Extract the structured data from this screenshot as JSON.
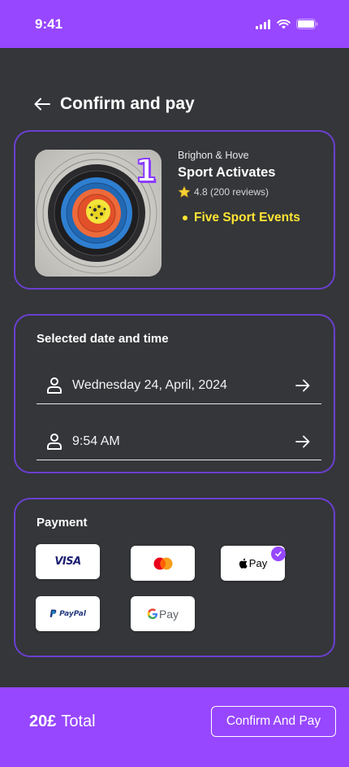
{
  "status_bar": {
    "time": "9:41",
    "background": "#9747ff"
  },
  "header": {
    "title": "Confirm and pay",
    "back_icon": "arrow-left-icon"
  },
  "event": {
    "location": "Brighon & Hove",
    "name": "Sport Activates",
    "rating": "4.8 (200 reviews)",
    "highlight": "Five Sport Events",
    "badge": "1",
    "highlight_color": "#ffe433"
  },
  "schedule": {
    "title": "Selected date and time",
    "date": "Wednesday 24, April, 2024",
    "time": "9:54 AM"
  },
  "payment": {
    "title": "Payment",
    "methods": [
      {
        "name": "VISA",
        "icon": "visa-logo",
        "selected": false
      },
      {
        "name": "Mastercard",
        "icon": "mastercard-logo",
        "selected": false
      },
      {
        "name": "Pay",
        "icon": "apple-pay-logo",
        "selected": true
      },
      {
        "name": "PayPal",
        "icon": "paypal-logo",
        "selected": false
      },
      {
        "name": "Pay",
        "icon": "google-pay-logo",
        "selected": false
      }
    ]
  },
  "footer": {
    "total_amount": "20£",
    "total_label": "Total",
    "confirm_label": "Confirm And Pay"
  },
  "colors": {
    "accent": "#9747ff",
    "card_border": "#6b3fd0",
    "background": "#343639"
  }
}
